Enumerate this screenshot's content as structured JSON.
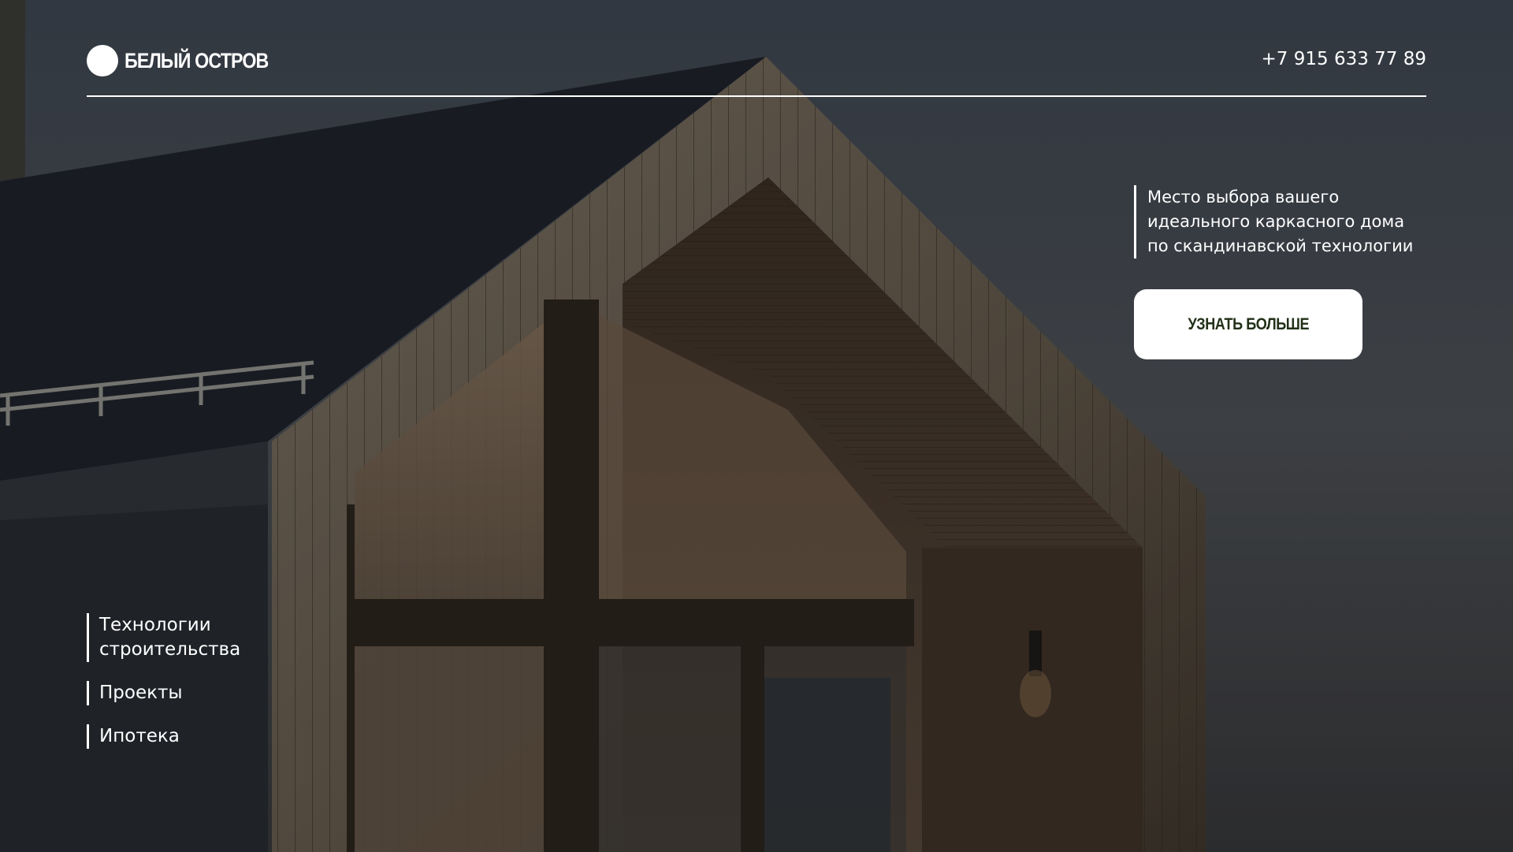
{
  "header": {
    "logo_text": "БЕЛЫЙ ОСТРОВ",
    "phone": "+7 915 633 77 89"
  },
  "hero": {
    "tagline_lines": [
      "Место выбора вашего",
      "идеального каркасного дома",
      "по скандинавской технологии"
    ],
    "cta_label": "УЗНАТЬ БОЛЬШЕ",
    "background_image": "modern-barnhouse-photo"
  },
  "nav": {
    "items": [
      {
        "lines": [
          "Технологии",
          "строительства"
        ]
      },
      {
        "lines": [
          "Проекты"
        ]
      },
      {
        "lines": [
          "Ипотека"
        ]
      }
    ]
  },
  "colors": {
    "text": "#ffffff",
    "cta_background": "#ffffff",
    "cta_text": "#223018"
  }
}
